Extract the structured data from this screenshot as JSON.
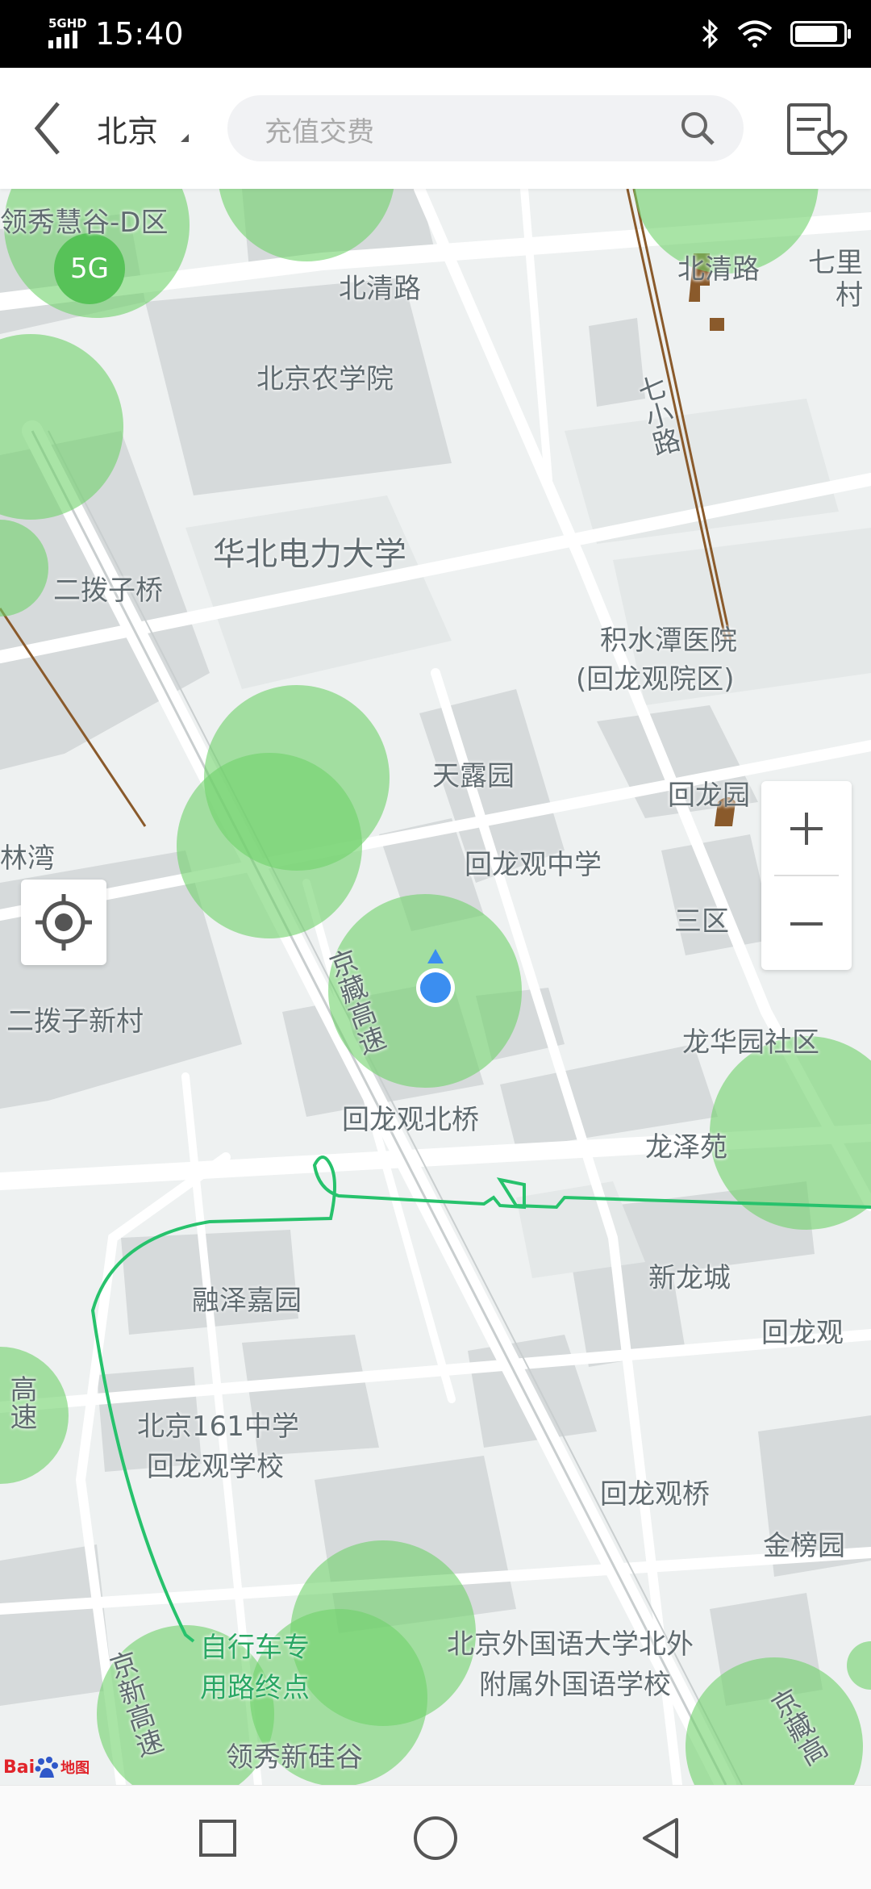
{
  "status_bar": {
    "network_tag": "5GHD",
    "time": "15:40",
    "icons": [
      "bluetooth-icon",
      "wifi-icon",
      "battery-icon"
    ]
  },
  "header": {
    "city": "北京",
    "search_placeholder": "充值交费",
    "icons": [
      "back-arrow-icon",
      "search-icon",
      "favorites-list-icon"
    ]
  },
  "map": {
    "badge_5g": "5G",
    "labels": {
      "lingxiu_d": "领秀慧谷-D区",
      "beiqing_road": "北清路",
      "beiqing_road_2": "北清路",
      "qili_village": "七里村",
      "nongxueyuan": "北京农学院",
      "qixiao_road": "七小路",
      "huabei_dianli": "华北电力大学",
      "erbozi_bridge": "二拨子桥",
      "jishuitan": "积水潭医院",
      "jishuitan_sub": "(回龙观院区)",
      "tianlu_yuan": "天露园",
      "huilongyuan": "回龙园",
      "linwan": "林湾",
      "hlg_middle_school": "回龙观中学",
      "sanqu": "三区",
      "erbozi_xincun": "二拨子新村",
      "jingzang_expressway": "京藏高速",
      "longhuayuan": "龙华园社区",
      "hlg_north_bridge": "回龙观北桥",
      "longzeyuan": "龙泽苑",
      "rongze_jiayuan": "融泽嘉园",
      "xinlongcheng": "新龙城",
      "hlg_east": "回龙观",
      "school161": "北京161中学",
      "school161_sub": "回龙观学校",
      "gao_su_left": "高速",
      "hlg_bridge": "回龙观桥",
      "jinbangyuan": "金榜园",
      "bike_end_1": "自行车专",
      "bike_end_2": "用路终点",
      "bfsu_1": "北京外国语大学北外",
      "bfsu_2": "附属外国语学校",
      "jingxin_expressway": "京新高速",
      "lingxiu_xingu": "领秀新硅谷",
      "jingzang_bottom": "京藏高"
    },
    "logo": {
      "text": "Bai",
      "text2": "地图"
    },
    "colors": {
      "coverage": "#6fd26a",
      "route": "#27c26c",
      "location": "#3b8ef0",
      "map_bg": "#eef1f1"
    }
  },
  "navbar": {
    "icons": [
      "recent-apps-icon",
      "home-icon",
      "back-icon"
    ]
  }
}
